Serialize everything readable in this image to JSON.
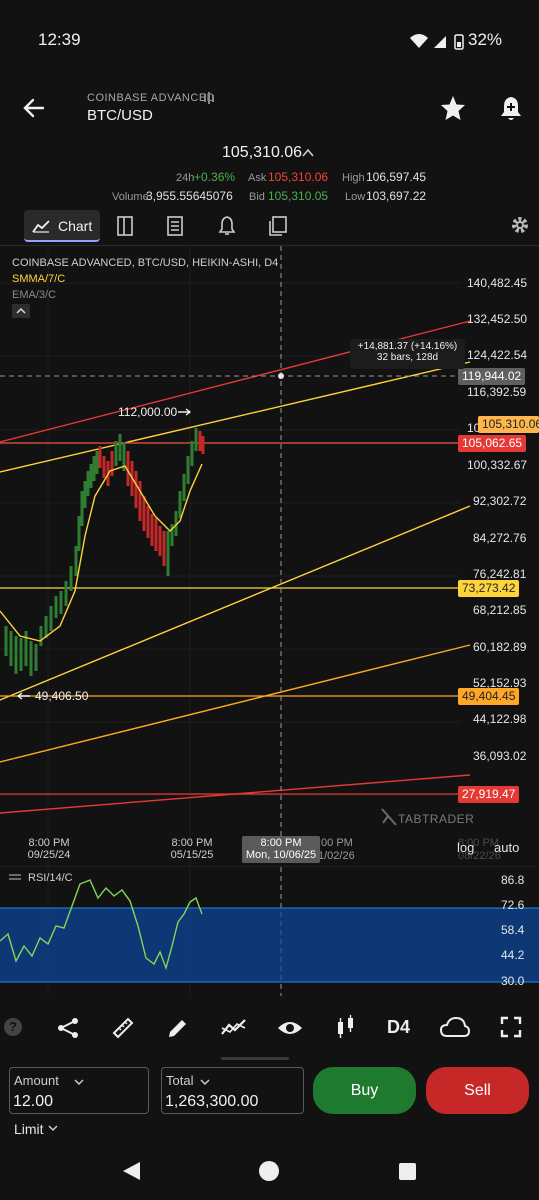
{
  "status_bar": {
    "time": "12:39",
    "battery": "32%"
  },
  "app_bar": {
    "exchange": "COINBASE ADVANCED",
    "pair": "BTC/USD"
  },
  "quote": {
    "last": "105,310.06",
    "change_label": "24h",
    "change": "+0.36%",
    "volume_label": "Volume",
    "volume": "3,955.55645076",
    "ask_label": "Ask",
    "ask": "105,310.06",
    "bid_label": "Bid",
    "bid": "105,310.05",
    "high_label": "High",
    "high": "106,597.45",
    "low_label": "Low",
    "low": "103,697.22"
  },
  "tabs": {
    "chart": "Chart"
  },
  "chart": {
    "legend_title": "COINBASE ADVANCED, BTC/USD, HEIKIN-ASHI, D4",
    "indicator1": "SMMA/7/C",
    "indicator2": "EMA/3/C",
    "price_axis": [
      "140,482.45",
      "132,452.50",
      "124,422.54",
      "116,392.59",
      "100,332.67",
      "92,302.72",
      "84,272.76",
      "76,242.81",
      "68,212.85",
      "60,182.89",
      "52,152.93",
      "44,122.98",
      "36,093.02"
    ],
    "partial_label_10": "10",
    "tags": {
      "crosshair": "119,944.02",
      "last": "105,310.06",
      "line1": "105,062.65",
      "line2": "73,273.42",
      "line3": "49,404.45",
      "line4": "27,919.47"
    },
    "measure": {
      "line1": "+14,881.37 (+14.16%)",
      "line2": "32 bars, 128d"
    },
    "annotations": {
      "high": "112,000.00",
      "low": "49,406.50"
    },
    "time_axis": [
      {
        "t1": "8:00 PM",
        "t2": "09/25/24"
      },
      {
        "t1": "8:00 PM",
        "t2": "05/15/25"
      }
    ],
    "crosshair_time": {
      "t1": "8:00 PM",
      "t2": "Mon, 10/06/25"
    },
    "partial_times": {
      "a": ":00 PM",
      "b": "1/02/26",
      "c": "8:00 PM",
      "d": "08/22/26"
    },
    "log_label": "log",
    "auto_label": "auto",
    "watermark": "TABTRADER",
    "rsi": {
      "label": "RSI/14/C",
      "levels": [
        "86.8",
        "72.6",
        "58.4",
        "44.2",
        "30.0"
      ]
    }
  },
  "toolbar": {
    "timeframe": "D4"
  },
  "order": {
    "amount_label": "Amount",
    "amount": "12.00",
    "total_label": "Total",
    "total": "1,263,300.00",
    "buy": "Buy",
    "sell": "Sell",
    "type": "Limit"
  },
  "colors": {
    "green": "#4caf50",
    "red": "#f44336",
    "yellow": "#ffd43b",
    "orange": "#ffa726",
    "rsi_band": "#0d47a1"
  }
}
